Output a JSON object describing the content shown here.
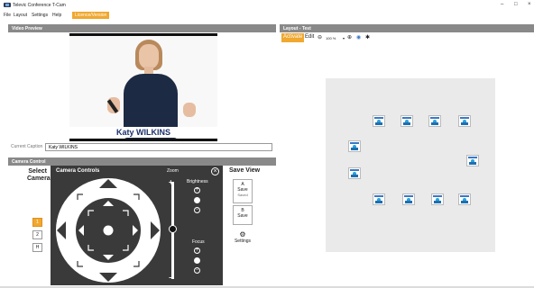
{
  "window": {
    "title": "Televic Conference T-Cam",
    "minimize": "–",
    "maximize": "□",
    "close": "×"
  },
  "menu": {
    "items": [
      "File",
      "Layout",
      "Settings",
      "Help"
    ],
    "active": "Licence/Version"
  },
  "video_preview": {
    "header": "Video Preview",
    "overlay_name": "Katy WILKINS",
    "caption_label": "Current Caption",
    "caption_value": "Katy WILKINS"
  },
  "camera_control": {
    "header": "Camera Control",
    "select_camera": "Select Camera",
    "cameras": [
      "1",
      "2",
      "H"
    ],
    "selected_camera": "1",
    "controls_title": "Camera Controls",
    "zoom_label": "Zoom",
    "brightness_label": "Brightness",
    "focus_label": "Focus",
    "close_icon": "close-icon",
    "save_view_title": "Save View",
    "save_a": {
      "letter": "A",
      "label": "Save",
      "sub": "Saved"
    },
    "save_b": {
      "letter": "B",
      "label": "Save"
    },
    "settings_label": "Settings"
  },
  "layout": {
    "header": "Layout - Test",
    "activate": "Activate",
    "edit": "Edit",
    "zoom_level": "100 %"
  },
  "colors": {
    "accent": "#f0a830",
    "panel_header": "#898989",
    "controls_bg": "#3a3a3a"
  }
}
